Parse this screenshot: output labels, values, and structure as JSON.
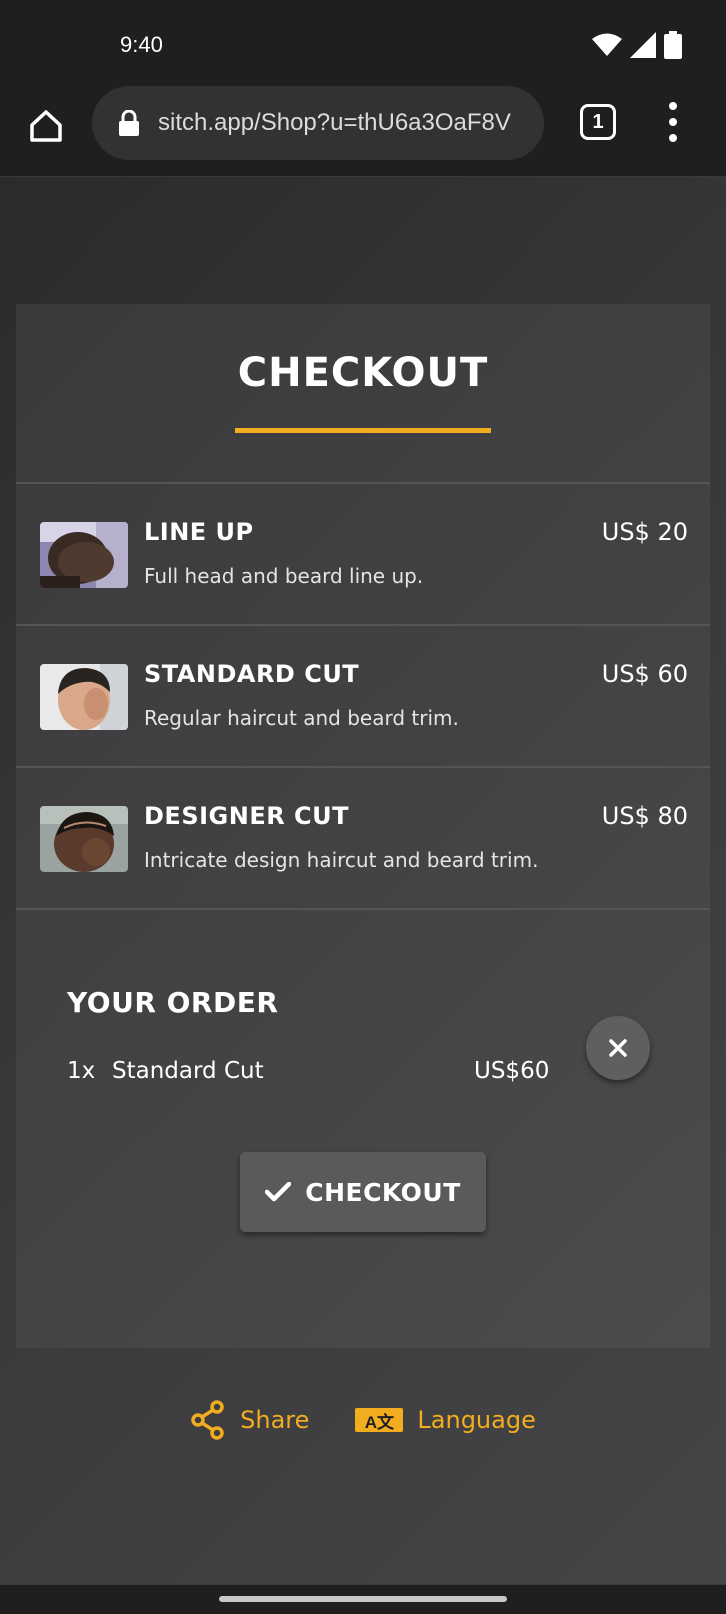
{
  "status_bar": {
    "time": "9:40",
    "icons": [
      "wifi-icon",
      "signal-icon",
      "battery-icon"
    ]
  },
  "browser": {
    "url": "sitch.app/Shop?u=thU6a3OaF8V",
    "tab_count": "1"
  },
  "checkout": {
    "title": "CHECKOUT",
    "accent_color": "#f1ad1f",
    "services": [
      {
        "name": "LINE UP",
        "description": "Full head and beard line up.",
        "price": "US$ 20"
      },
      {
        "name": "STANDARD CUT",
        "description": "Regular haircut and beard trim.",
        "price": "US$ 60"
      },
      {
        "name": "DESIGNER CUT",
        "description": "Intricate design haircut and beard trim.",
        "price": "US$ 80"
      }
    ],
    "order": {
      "title": "YOUR ORDER",
      "items": [
        {
          "qty": "1x",
          "name": "Standard Cut",
          "price": "US$60"
        }
      ]
    },
    "checkout_button": "CHECKOUT"
  },
  "footer": {
    "share_label": "Share",
    "language_label": "Language",
    "language_badge": "A文"
  }
}
